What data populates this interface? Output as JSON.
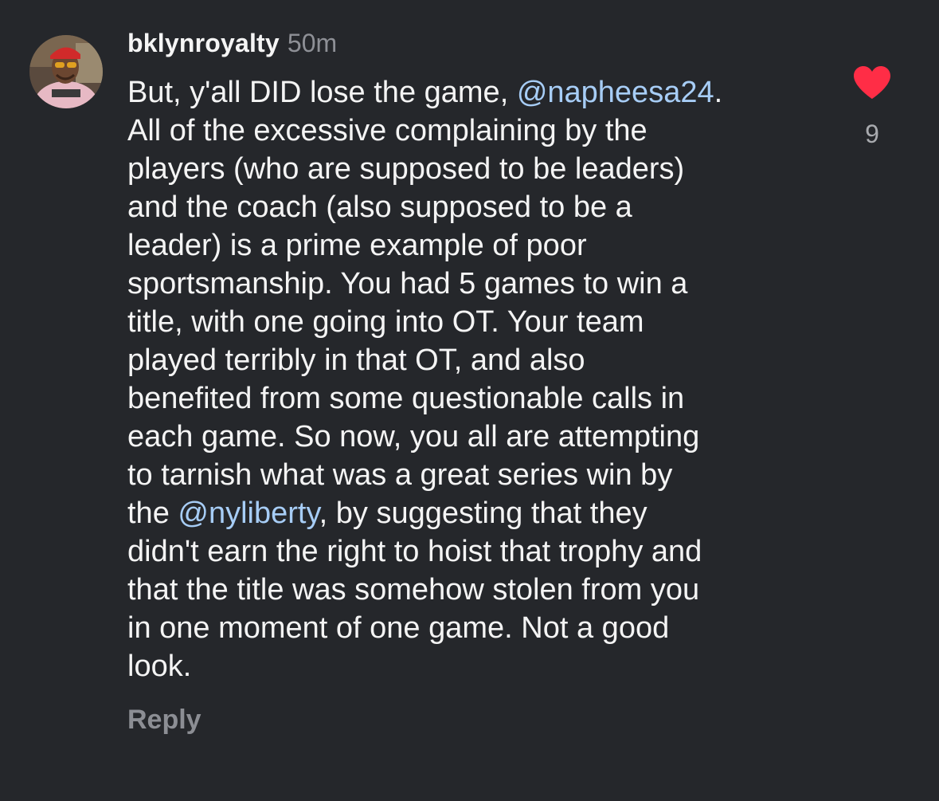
{
  "comment": {
    "username": "bklynroyalty",
    "timestamp": "50m",
    "body_lines": [
      {
        "before": "But, y'all DID lose the game, ",
        "mention": "@napheesa24",
        "after": "."
      },
      {
        "text": "All of the excessive complaining by the"
      },
      {
        "text": "players (who are supposed to be leaders)"
      },
      {
        "text": "and the coach (also supposed to be a"
      },
      {
        "text": "leader) is a prime example of poor"
      },
      {
        "text": "sportsmanship. You had 5 games to win a"
      },
      {
        "text": "title, with one going into OT. Your team"
      },
      {
        "text": "played terribly in that OT, and also"
      },
      {
        "text": "benefited from some questionable calls in"
      },
      {
        "text": "each game. So now, you all are attempting"
      },
      {
        "text": "to tarnish what was a great series win by"
      },
      {
        "before": "the ",
        "mention": "@nyliberty",
        "after": ", by suggesting that they"
      },
      {
        "text": "didn't earn the right to hoist that trophy and"
      },
      {
        "text": "that the title was somehow stolen from you"
      },
      {
        "text": "in one moment of one game. Not a good"
      },
      {
        "text": "look."
      }
    ],
    "reply_label": "Reply",
    "like_count": "9",
    "like_icon": "heart-icon",
    "colors": {
      "background": "#25272b",
      "mention": "#a7cdf6",
      "heart": "#ff2d46"
    }
  }
}
